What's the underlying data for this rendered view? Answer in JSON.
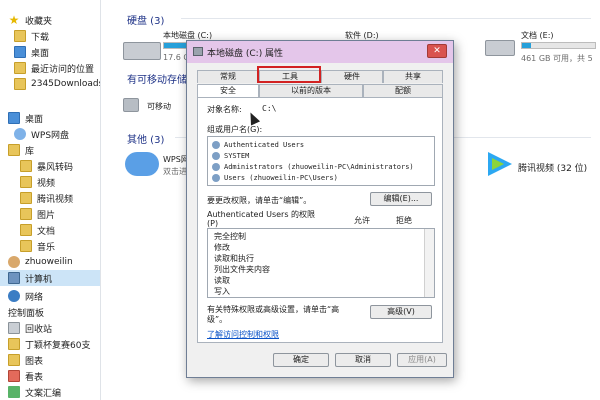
{
  "nav": {
    "items": [
      {
        "label": "收藏夹",
        "icon": "star-icon",
        "kind": "star"
      },
      {
        "label": "下载",
        "icon": "folder-icon",
        "kind": "folder"
      },
      {
        "label": "桌面",
        "icon": "desktop-icon",
        "kind": "blue"
      },
      {
        "label": "最近访问的位置",
        "icon": "recent-icon",
        "kind": "folder"
      },
      {
        "label": "2345Downloads",
        "icon": "folder-icon",
        "kind": "folder"
      },
      {
        "label": "桌面",
        "icon": "desktop-icon",
        "kind": "blue"
      },
      {
        "label": "WPS网盘",
        "icon": "cloud-icon",
        "kind": "cloud"
      },
      {
        "label": "库",
        "icon": "library-icon",
        "kind": "folder"
      },
      {
        "label": "暴风转码",
        "icon": "folder-icon",
        "kind": "folder"
      },
      {
        "label": "视频",
        "icon": "video-icon",
        "kind": "folder"
      },
      {
        "label": "腾讯视频",
        "icon": "tencent-video-icon",
        "kind": "folder"
      },
      {
        "label": "图片",
        "icon": "picture-icon",
        "kind": "folder"
      },
      {
        "label": "文档",
        "icon": "document-icon",
        "kind": "folder"
      },
      {
        "label": "音乐",
        "icon": "music-icon",
        "kind": "folder"
      },
      {
        "label": "zhuoweilin",
        "icon": "user-icon",
        "kind": "user"
      },
      {
        "label": "计算机",
        "icon": "computer-icon",
        "kind": "pc"
      },
      {
        "label": "网络",
        "icon": "network-icon",
        "kind": "net"
      },
      {
        "label": "控制面板",
        "icon": "control-panel-icon",
        "kind": "panel"
      },
      {
        "label": "回收站",
        "icon": "recycle-bin-icon",
        "kind": "trash"
      },
      {
        "label": "丁颖杯复赛60支",
        "icon": "folder-icon",
        "kind": "folder"
      },
      {
        "label": "图表",
        "icon": "folder-icon",
        "kind": "folder"
      },
      {
        "label": "看表",
        "icon": "folder-icon",
        "kind": "red"
      },
      {
        "label": "文案汇编",
        "icon": "folder-icon",
        "kind": "green"
      }
    ],
    "selected_index": 15
  },
  "main": {
    "hard_disk_title": "硬盘 (3)",
    "removable_title": "有可移动存储",
    "others_title": "其他 (3)",
    "drives": [
      {
        "label": "本地磁盘 (C:)",
        "free": "17.6 G",
        "fill": 0.8
      },
      {
        "label": "软件 (D:)",
        "free": "",
        "fill": 0
      },
      {
        "label": "文档 (E:)",
        "free": "461 GB 可用，共 5",
        "fill": 0.12
      }
    ],
    "removable_item": "可移动",
    "wps_label": "WPS网",
    "wps_sub": "双击进",
    "tencent_label": "腾讯视频 (32 位)"
  },
  "dialog": {
    "title": "本地磁盘 (C:) 属性",
    "close": "✕",
    "tabs_row1": [
      "常规",
      "工具",
      "硬件",
      "共享"
    ],
    "tabs_row2": [
      "安全",
      "以前的版本",
      "配额"
    ],
    "object_label": "对象名称:",
    "object_value": "C:\\",
    "group_label": "组或用户名(G):",
    "users": [
      "Authenticated Users",
      "SYSTEM",
      "Administrators (zhuoweilin-PC\\Administrators)",
      "Users (zhuoweilin-PC\\Users)"
    ],
    "change_perm_label": "要更改权限，请单击“编辑”。",
    "edit_button": "编辑(E)...",
    "perm_for": "Authenticated Users 的权限",
    "perm_for_line2": "(P)",
    "allow": "允许",
    "deny": "拒绝",
    "permissions": [
      "完全控制",
      "修改",
      "读取和执行",
      "列出文件夹内容",
      "读取",
      "写入"
    ],
    "special_label": "有关特殊权限或高级设置，请单击“高",
    "special_label2": "级”。",
    "advanced_button": "高级(V)",
    "link": "了解访问控制和权限",
    "ok": "确定",
    "cancel": "取消",
    "apply": "应用(A)"
  },
  "colors": {
    "title_bar": "#e4c6ea",
    "highlight": "#d22222",
    "group_title": "#1e3287",
    "drive_fill": "#26a0da"
  }
}
